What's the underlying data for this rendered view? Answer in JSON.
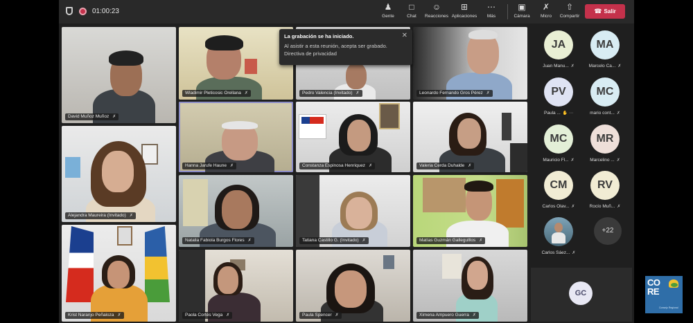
{
  "meeting": {
    "timer": "01:00:23",
    "toolbar": [
      {
        "id": "people",
        "label": "Gente",
        "icon": "people-icon"
      },
      {
        "id": "chat",
        "label": "Chat",
        "icon": "chat-icon"
      },
      {
        "id": "reactions",
        "label": "Reacciones",
        "icon": "reactions-icon"
      },
      {
        "id": "apps",
        "label": "Aplicaciones",
        "icon": "apps-icon"
      },
      {
        "id": "more",
        "label": "Más",
        "icon": "more-icon"
      },
      {
        "id": "camera",
        "label": "Cámara",
        "icon": "camera-off-icon"
      },
      {
        "id": "mic",
        "label": "Micro",
        "icon": "mic-off-icon"
      },
      {
        "id": "share",
        "label": "Compartir",
        "icon": "share-icon"
      }
    ],
    "leave_label": "Salir",
    "recording_toast": {
      "title": "La grabación se ha iniciado.",
      "body": "Al asistir a esta reunión, acepta ser grabado.",
      "link": "Directiva de privacidad"
    },
    "participants": [
      "David Muñoz Muñoz",
      "Wladimir Pleticosic Orellana",
      "Pedro Valencia (Invitado)",
      "Leonardo Fernando Gros Pérez",
      "Hanna Jarufe Haune",
      "Constanza Espinosa Henriquez",
      "Valeria Cerda Duhalde",
      "Alejandra Maureira (Invitado)",
      "Natalia Fabiola Burgos Flores",
      "Tatiana Castillo G. (Invitado)",
      "Matías Guzmán Gallegulllos",
      "Krist Naranjo Peñaloza",
      "Paola Cortés Vega",
      "Paula Spencer",
      "Ximena Ampuero Guerra"
    ],
    "roster": [
      {
        "initials": "JA",
        "name": "Juan Manu...",
        "color": "#e9efd4"
      },
      {
        "initials": "MA",
        "name": "Marcelo Ca...",
        "color": "#d8ecf3"
      },
      {
        "initials": "PV",
        "name": "Paula ...",
        "color": "#dfe3f3"
      },
      {
        "initials": "MC",
        "name": "mario cont...",
        "color": "#d8ecf3"
      },
      {
        "initials": "MC",
        "name": "Mauricio Fl...",
        "color": "#e3efd7"
      },
      {
        "initials": "MR",
        "name": "Marcelino ...",
        "color": "#eedfd9"
      },
      {
        "initials": "CM",
        "name": "Carlos Olav...",
        "color": "#f1ecd4"
      },
      {
        "initials": "RV",
        "name": "Rocío Muñ...",
        "color": "#f1ecd4"
      },
      {
        "initials": "",
        "name": "Carlos Sáez...",
        "color": "#4a6a7a"
      }
    ],
    "overflow_count": "+22",
    "self_initials": "GC"
  },
  "logo": {
    "text_line1": "CO",
    "text_line2": "RE",
    "subtext": "Consejo Regional"
  }
}
